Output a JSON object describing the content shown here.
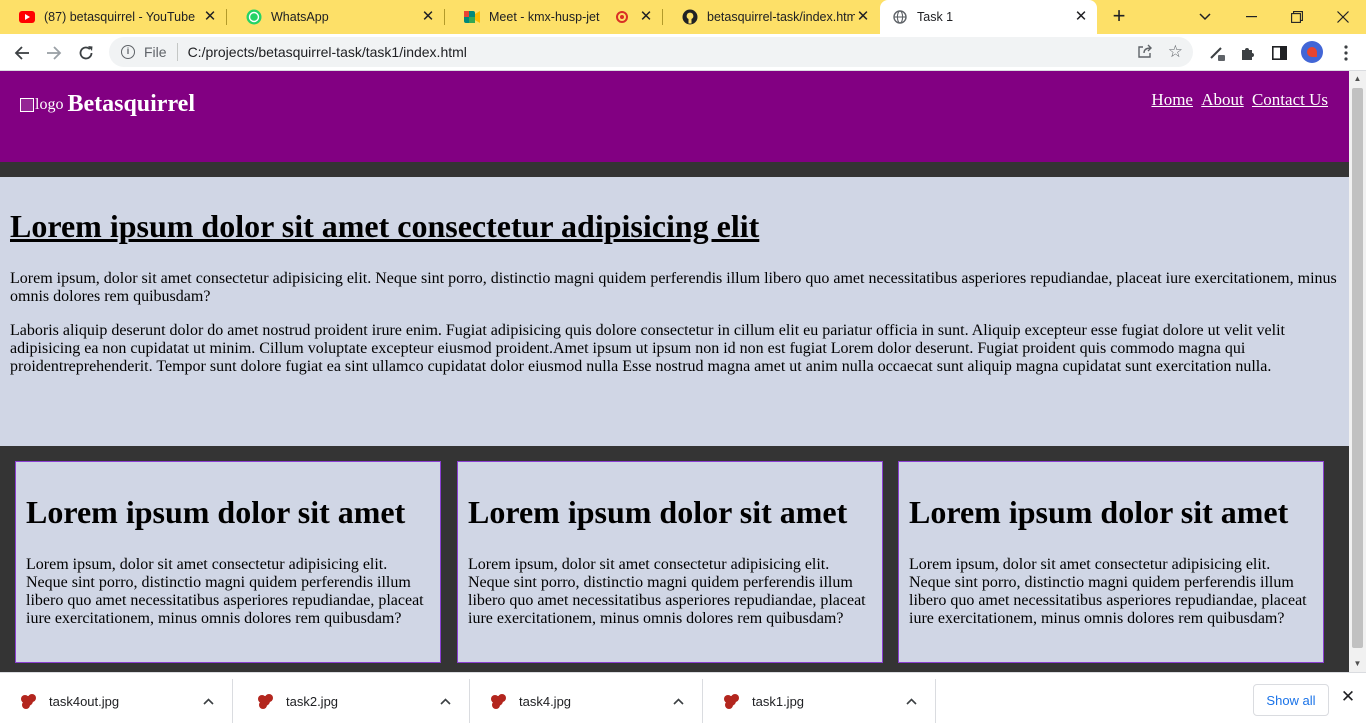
{
  "browser": {
    "tabs": [
      {
        "title": "(87) betasquirrel - YouTube",
        "icon": "youtube-icon"
      },
      {
        "title": "WhatsApp",
        "icon": "whatsapp-icon"
      },
      {
        "title": "Meet - kmx-husp-jet",
        "icon": "google-meet-icon",
        "recording": true
      },
      {
        "title": "betasquirrel-task/index.html",
        "icon": "github-icon"
      },
      {
        "title": "Task 1",
        "icon": "globe-icon",
        "active": true
      }
    ],
    "address": {
      "scheme_label": "File",
      "url": "C:/projects/betasquirrel-task/task1/index.html"
    }
  },
  "site": {
    "header": {
      "logo_alt": "logo",
      "brand": "Betasquirrel",
      "nav": [
        "Home",
        "About",
        "Contact Us"
      ]
    },
    "hero": {
      "title": "Lorem ipsum dolor sit amet consectetur adipisicing elit",
      "paragraphs": [
        "Lorem ipsum, dolor sit amet consectetur adipisicing elit. Neque sint porro, distinctio magni quidem perferendis illum libero quo amet necessitatibus asperiores repudiandae, placeat iure exercitationem, minus omnis dolores rem quibusdam?",
        "Laboris aliquip deserunt dolor do amet nostrud proident irure enim. Fugiat adipisicing quis dolore consectetur in cillum elit eu pariatur officia in sunt. Aliquip excepteur esse fugiat dolore ut velit velit adipisicing ea non cupidatat ut minim. Cillum voluptate excepteur eiusmod proident.Amet ipsum ut ipsum non id non est fugiat Lorem dolor deserunt. Fugiat proident quis commodo magna qui proidentreprehenderit. Tempor sunt dolore fugiat ea sint ullamco cupidatat dolor eiusmod nulla Esse nostrud magna amet ut anim nulla occaecat sunt aliquip magna cupidatat sunt exercitation nulla."
      ]
    },
    "cards": [
      {
        "title": "Lorem ipsum dolor sit amet",
        "text": "Lorem ipsum, dolor sit amet consectetur adipisicing elit. Neque sint porro, distinctio magni quidem perferendis illum libero quo amet necessitatibus asperiores repudiandae, placeat iure exercitationem, minus omnis dolores rem quibusdam?"
      },
      {
        "title": "Lorem ipsum dolor sit amet",
        "text": "Lorem ipsum, dolor sit amet consectetur adipisicing elit. Neque sint porro, distinctio magni quidem perferendis illum libero quo amet necessitatibus asperiores repudiandae, placeat iure exercitationem, minus omnis dolores rem quibusdam?"
      },
      {
        "title": "Lorem ipsum dolor sit amet",
        "text": "Lorem ipsum, dolor sit amet consectetur adipisicing elit. Neque sint porro, distinctio magni quidem perferendis illum libero quo amet necessitatibus asperiores repudiandae, placeat iure exercitationem, minus omnis dolores rem quibusdam?"
      }
    ]
  },
  "downloads": {
    "items": [
      "task4out.jpg",
      "task2.jpg",
      "task4.jpg",
      "task1.jpg"
    ],
    "show_all": "Show all"
  },
  "colors": {
    "tabstrip": "#fde068",
    "header": "#820082",
    "band": "#343434",
    "content": "#d0d6e5",
    "card_border": "#8a3fd1"
  }
}
